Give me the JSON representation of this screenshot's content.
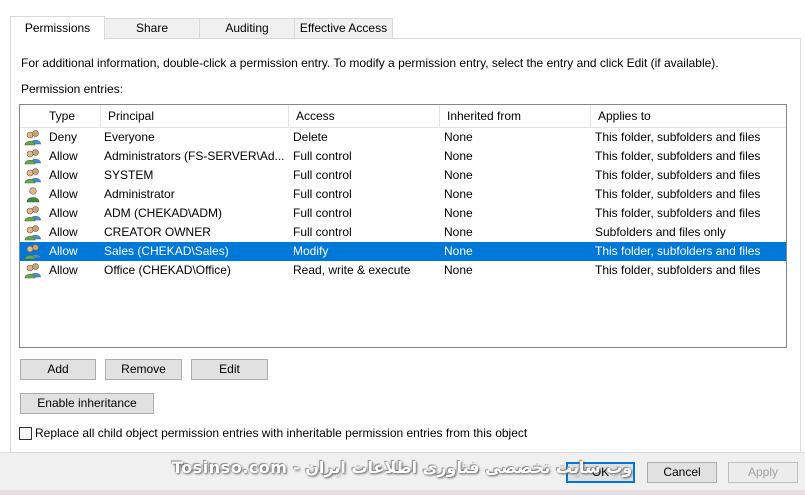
{
  "tabs": [
    {
      "label": "Permissions",
      "active": true
    },
    {
      "label": "Share",
      "active": false
    },
    {
      "label": "Auditing",
      "active": false
    },
    {
      "label": "Effective Access",
      "active": false
    }
  ],
  "info_text": "For additional information, double-click a permission entry. To modify a permission entry, select the entry and click Edit (if available).",
  "entries_label": "Permission entries:",
  "columns": [
    "Type",
    "Principal",
    "Access",
    "Inherited from",
    "Applies to"
  ],
  "entries": [
    {
      "icon": "group-icon",
      "type": "Deny",
      "principal": "Everyone",
      "access": "Delete",
      "inherited": "None",
      "applies": "This folder, subfolders and files",
      "selected": false
    },
    {
      "icon": "group-icon",
      "type": "Allow",
      "principal": "Administrators (FS-SERVER\\Ad...",
      "access": "Full control",
      "inherited": "None",
      "applies": "This folder, subfolders and files",
      "selected": false
    },
    {
      "icon": "group-icon",
      "type": "Allow",
      "principal": "SYSTEM",
      "access": "Full control",
      "inherited": "None",
      "applies": "This folder, subfolders and files",
      "selected": false
    },
    {
      "icon": "user-icon",
      "type": "Allow",
      "principal": "Administrator",
      "access": "Full control",
      "inherited": "None",
      "applies": "This folder, subfolders and files",
      "selected": false
    },
    {
      "icon": "group-icon",
      "type": "Allow",
      "principal": "ADM (CHEKAD\\ADM)",
      "access": "Full control",
      "inherited": "None",
      "applies": "This folder, subfolders and files",
      "selected": false
    },
    {
      "icon": "group-icon",
      "type": "Allow",
      "principal": "CREATOR OWNER",
      "access": "Full control",
      "inherited": "None",
      "applies": "Subfolders and files only",
      "selected": false
    },
    {
      "icon": "group-icon",
      "type": "Allow",
      "principal": "Sales (CHEKAD\\Sales)",
      "access": "Modify",
      "inherited": "None",
      "applies": "This folder, subfolders and files",
      "selected": true
    },
    {
      "icon": "group-icon",
      "type": "Allow",
      "principal": "Office (CHEKAD\\Office)",
      "access": "Read, write & execute",
      "inherited": "None",
      "applies": "This folder, subfolders and files",
      "selected": false
    }
  ],
  "buttons": {
    "add": "Add",
    "remove": "Remove",
    "edit": "Edit",
    "enable_inheritance": "Enable inheritance",
    "ok": "OK",
    "cancel": "Cancel",
    "apply": "Apply"
  },
  "replace_checkbox": {
    "label": "Replace all child object permission entries with inheritable permission entries from this object",
    "checked": false
  },
  "watermark": "وب سایت تخصصی فناوری اطلاعات ایران - Tosinso.com",
  "colors": {
    "selection": "#0078d7",
    "default_button_border": "#0078d7"
  }
}
